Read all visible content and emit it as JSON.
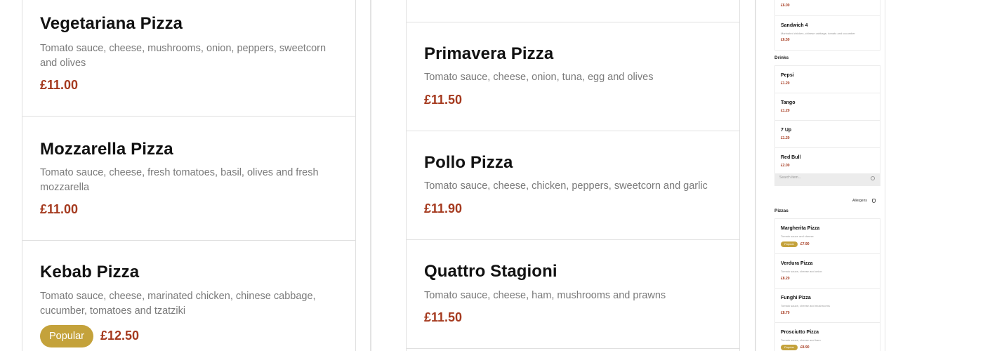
{
  "column1": [
    {
      "name": "Vegetariana Pizza",
      "desc": "Tomato sauce, cheese, mushrooms, onion, peppers, sweetcorn and olives",
      "price": "£11.00"
    },
    {
      "name": "Mozzarella Pizza",
      "desc": "Tomato sauce, cheese, fresh tomatoes, basil, olives and fresh mozzarella",
      "price": "£11.00"
    },
    {
      "name": "Kebab Pizza",
      "desc": "Tomato sauce, cheese, marinated chicken, chinese cabbage, cucumber, tomatoes and tzatziki",
      "badge": "Popular",
      "price": "£12.50"
    }
  ],
  "column2": [
    {
      "name": "Primavera Pizza",
      "desc": "Tomato sauce, cheese, onion, tuna, egg and olives",
      "price": "£11.50"
    },
    {
      "name": "Pollo Pizza",
      "desc": "Tomato sauce, cheese, chicken, peppers, sweetcorn and garlic",
      "price": "£11.90"
    },
    {
      "name": "Quattro Stagioni",
      "desc": "Tomato sauce, cheese, ham, mushrooms and prawns",
      "price": "£11.50"
    }
  ],
  "preview": {
    "top_price": "£6.00",
    "sandwich": {
      "name": "Sandwich 4",
      "desc": "Marinated chicken, chinese cabbage, tomato and cucumber",
      "price": "£6.50"
    },
    "drinks_heading": "Drinks",
    "drinks": [
      {
        "name": "Pepsi",
        "price": "£1.20"
      },
      {
        "name": "Tango",
        "price": "£1.20"
      },
      {
        "name": "7 Up",
        "price": "£1.20"
      },
      {
        "name": "Red Bull",
        "price": "£2.00"
      }
    ],
    "search_placeholder": "Search item...",
    "allergens_label": "Allergens",
    "pizzas_heading": "Pizzas",
    "pizzas": [
      {
        "name": "Margherita Pizza",
        "desc": "Tomato sauce and cheese",
        "badge": "Popular",
        "price": "£7.90"
      },
      {
        "name": "Verdura Pizza",
        "desc": "Tomato sauce, cheese and onion",
        "price": "£8.20"
      },
      {
        "name": "Funghi Pizza",
        "desc": "Tomato sauce, cheese and mushrooms",
        "price": "£8.70"
      },
      {
        "name": "Prosciutto Pizza",
        "desc": "Tomato sauce, cheese and ham",
        "badge": "Popular",
        "price": "£8.90"
      }
    ]
  },
  "colors": {
    "price": "#a53a1f",
    "badge": "#c4a23b",
    "border": "#e0e0e0"
  }
}
